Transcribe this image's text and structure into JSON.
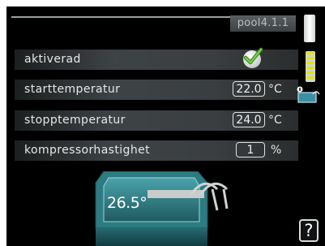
{
  "header": {
    "menu_id": "pool4.1.1"
  },
  "rows": [
    {
      "label": "aktiverad",
      "checked": true
    },
    {
      "label": "starttemperatur",
      "value": "22.0",
      "unit": "°C"
    },
    {
      "label": "stopptemperatur",
      "value": "24.0",
      "unit": "°C"
    },
    {
      "label": "kompressorhastighet",
      "value": "1",
      "unit": "%"
    }
  ],
  "pool": {
    "temperature": "26.5°"
  },
  "sidebar": {
    "help_label": "?"
  },
  "colors": {
    "background": "#000000",
    "pool_water": "#2f6f74",
    "pool_rim": "#3a8a90",
    "check_green": "#5fb53a"
  },
  "icons": [
    "checkmark-icon",
    "scroll-indicator-icon",
    "pool-icon",
    "help-icon"
  ]
}
